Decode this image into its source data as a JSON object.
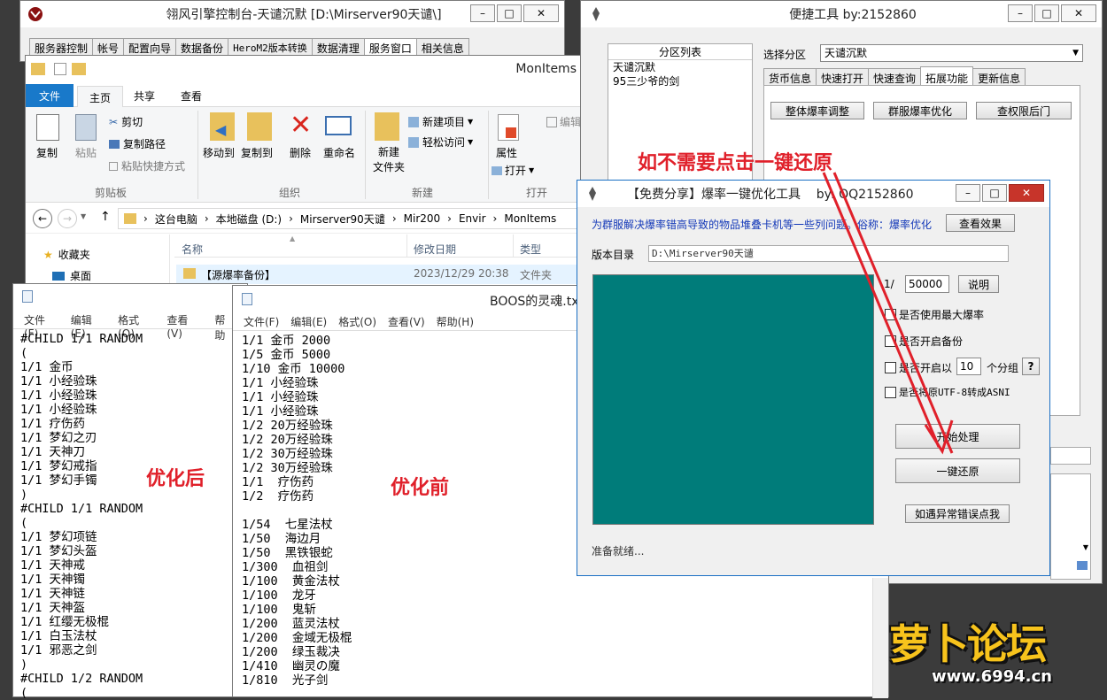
{
  "console": {
    "title": "翎风引擎控制台-天谴沉默 [D:\\Mirserver90天谴\\]",
    "tabs": [
      "服务器控制",
      "帐号",
      "配置向导",
      "数据备份",
      "HeroM2版本转换",
      "数据清理",
      "服务窗口",
      "相关信息"
    ]
  },
  "explorer": {
    "title": "MonItems",
    "ribbon_tabs": [
      "文件",
      "主页",
      "共享",
      "查看"
    ],
    "clipboard": {
      "copy": "复制",
      "paste": "粘贴",
      "cut": "剪切",
      "copy_path": "复制路径",
      "paste_shortcut": "粘贴快捷方式",
      "group": "剪贴板"
    },
    "organize": {
      "move_to": "移动到",
      "copy_to": "复制到",
      "delete": "删除",
      "rename": "重命名",
      "group": "组织"
    },
    "new": {
      "new_folder_line1": "新建",
      "new_folder_line2": "文件夹",
      "new_item": "新建项目",
      "easy_access": "轻松访问",
      "group": "新建"
    },
    "open": {
      "properties": "属性",
      "open": "打开",
      "edit": "编辑",
      "group": "打开"
    },
    "breadcrumb": [
      "这台电脑",
      "本地磁盘 (D:)",
      "Mirserver90天谴",
      "Mir200",
      "Envir",
      "MonItems"
    ],
    "nav": [
      "收藏夹",
      "桌面"
    ],
    "columns": {
      "name": "名称",
      "modified": "修改日期",
      "type": "类型"
    },
    "row": {
      "name": "【源爆率备份】",
      "modified": "2023/12/29 20:38",
      "type": "文件夹"
    }
  },
  "tools": {
    "title": "便捷工具 by:2152860",
    "list_header": "分区列表",
    "list_items": [
      "天谴沉默",
      "95三少爷的剑"
    ],
    "select_label": "选择分区",
    "select_value": "天谴沉默",
    "tabs": [
      "货币信息",
      "快速打开",
      "快速查询",
      "拓展功能",
      "更新信息"
    ],
    "buttons": [
      "整体爆率调整",
      "群服爆率优化",
      "查权限后门"
    ]
  },
  "annotation": "如不需要点击一键还原",
  "optimizer": {
    "title": "【免费分享】爆率一键优化工具    by: QQ2152860",
    "desc": "为群服解决爆率错高导致的物品堆叠卡机等一些列问题。俗称：爆率优化",
    "view_effect": "查看效果",
    "dir_label": "版本目录",
    "dir_value": "D:\\Mirserver90天谴",
    "ratio_prefix": "1/",
    "ratio_value": "50000",
    "explain": "说明",
    "opt_max": "是否使用最大爆率",
    "opt_backup": "是否开启备份",
    "opt_group_pre": "是否开启以",
    "opt_group_value": "10",
    "opt_group_suf": "个分组",
    "help": "?",
    "opt_utf8": "是否将原UTF-8转成ASNI",
    "start": "开始处理",
    "restore": "一键还原",
    "error": "如遇异常错误点我",
    "status": "准备就绪..."
  },
  "notepad_after": {
    "menu": [
      "文件(F)",
      "编辑(E)",
      "格式(O)",
      "查看(V)",
      "帮助"
    ],
    "lines": "#CHILD 1/1 RANDOM\n(\n1/1 金币\n1/1 小经验珠\n1/1 小经验珠\n1/1 小经验珠\n1/1 疗伤药\n1/1 梦幻之刃\n1/1 天神刀\n1/1 梦幻戒指\n1/1 梦幻手镯\n)\n#CHILD 1/1 RANDOM\n(\n1/1 梦幻项链\n1/1 梦幻头盔\n1/1 天神戒\n1/1 天神镯\n1/1 天神链\n1/1 天神盔\n1/1 红缨无极棍\n1/1 白玉法杖\n1/1 邪恶之剑\n)\n#CHILD 1/2 RANDOM\n(",
    "label": "优化后"
  },
  "notepad_before": {
    "title": "BOOS的灵魂.tx",
    "menu": [
      "文件(F)",
      "编辑(E)",
      "格式(O)",
      "查看(V)",
      "帮助(H)"
    ],
    "lines": "1/1 金币 2000\n1/5 金币 5000\n1/10 金币 10000\n1/1 小经验珠\n1/1 小经验珠\n1/1 小经验珠\n1/2 20万经验珠\n1/2 20万经验珠\n1/2 30万经验珠\n1/2 30万经验珠\n1/1  疗伤药\n1/2  疗伤药\n\n1/54  七星法杖\n1/50  海边月\n1/50  黑铁银蛇\n1/300  血祖剑\n1/100  黄金法杖\n1/100  龙牙\n1/100  鬼斩\n1/200  蓝灵法杖\n1/200  金域无极棍\n1/200  绿玉裁决\n1/410  幽灵の魔\n1/810  光子剑",
    "label": "优化前"
  },
  "watermark": {
    "brand": "萝卜论坛",
    "url": "www.6994.cn"
  }
}
